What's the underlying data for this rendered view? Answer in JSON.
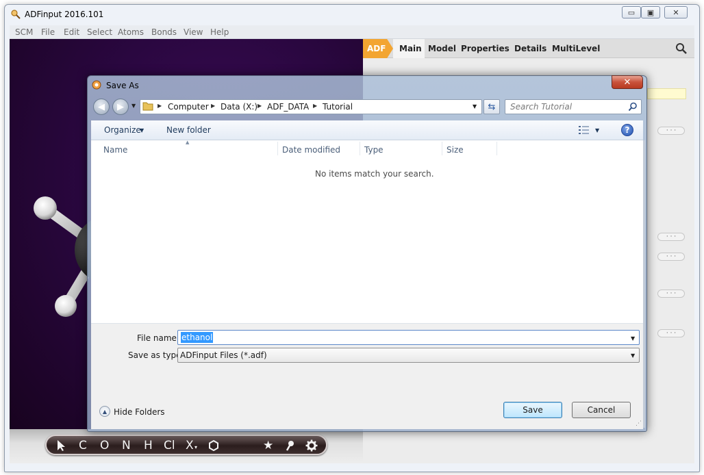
{
  "app": {
    "title": "ADFinput 2016.101",
    "window_buttons": {
      "minimize": "▭",
      "maximize": "▣",
      "close": "✕"
    }
  },
  "menu": [
    "SCM",
    "File",
    "Edit",
    "Select",
    "Atoms",
    "Bonds",
    "View",
    "Help"
  ],
  "panel": {
    "active_module": "ADF",
    "tabs": [
      "Main",
      "Model",
      "Properties",
      "Details",
      "MultiLevel"
    ],
    "active_tab": "Main",
    "more_button_label": "· · ·"
  },
  "toolbar_tools": [
    "C",
    "O",
    "N",
    "H",
    "Cl",
    "X",
    "★"
  ],
  "dialog": {
    "title": "Save As",
    "close_label": "✕",
    "breadcrumbs": [
      "Computer",
      "Data (X:)",
      "ADF_DATA",
      "Tutorial"
    ],
    "search_placeholder": "Search Tutorial",
    "toolbar": {
      "organize": "Organize",
      "new_folder": "New folder",
      "help": "?"
    },
    "columns": [
      "Name",
      "Date modified",
      "Type",
      "Size"
    ],
    "empty_message": "No items match your search.",
    "file_name_label": "File name:",
    "file_name_value": "ethanol",
    "save_type_label": "Save as type:",
    "save_type_value": "ADFinput Files (*.adf)",
    "hide_folders": "Hide Folders",
    "save_button": "Save",
    "cancel_button": "Cancel"
  },
  "colors": {
    "adf_tab": "#f3a531",
    "viewer_bg": "#2a0740",
    "selection": "#3399ff"
  }
}
